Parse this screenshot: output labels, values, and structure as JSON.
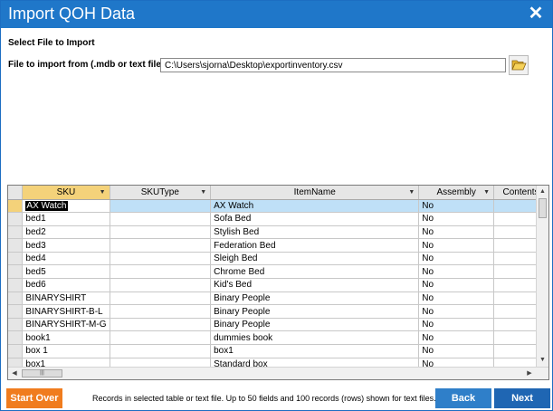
{
  "window": {
    "title": "Import QOH Data",
    "close_glyph": "✕"
  },
  "file_section": {
    "heading": "Select File to Import",
    "file_label": "File to import from (.mdb or text file)",
    "file_path": "C:\\Users\\sjorna\\Desktop\\exportinventory.csv",
    "browse_icon": "folder-open-icon"
  },
  "grid": {
    "columns": [
      "SKU",
      "SKUType",
      "ItemName",
      "Assembly",
      "Contents"
    ],
    "rows": [
      [
        "AX Watch",
        "",
        "AX Watch",
        "No",
        ""
      ],
      [
        "bed1",
        "",
        "Sofa Bed",
        "No",
        ""
      ],
      [
        "bed2",
        "",
        "Stylish Bed",
        "No",
        ""
      ],
      [
        "bed3",
        "",
        "Federation Bed",
        "No",
        ""
      ],
      [
        "bed4",
        "",
        "Sleigh Bed",
        "No",
        ""
      ],
      [
        "bed5",
        "",
        "Chrome Bed",
        "No",
        ""
      ],
      [
        "bed6",
        "",
        "Kid's Bed",
        "No",
        ""
      ],
      [
        "BINARYSHIRT",
        "",
        "Binary People",
        "No",
        ""
      ],
      [
        "BINARYSHIRT-B-L",
        "",
        "Binary People",
        "No",
        ""
      ],
      [
        "BINARYSHIRT-M-G",
        "",
        "Binary People",
        "No",
        ""
      ],
      [
        "book1",
        "",
        "dummies book",
        "No",
        ""
      ],
      [
        "box 1",
        "",
        "box1",
        "No",
        ""
      ],
      [
        "box1",
        "",
        "Standard box",
        "No",
        ""
      ]
    ]
  },
  "footer": {
    "start_over_label": "Start Over",
    "note": "Records in selected table or text file. Up to 50 fields and 100 records (rows) shown for text files.",
    "back_label": "Back",
    "next_label": "Next"
  },
  "colors": {
    "title_bar": "#1f77c9",
    "start_over": "#f07c1e",
    "back": "#2f7fc9",
    "next": "#1f66b3",
    "selected_row": "#bfe0f7",
    "active_header": "#f4d27a"
  }
}
